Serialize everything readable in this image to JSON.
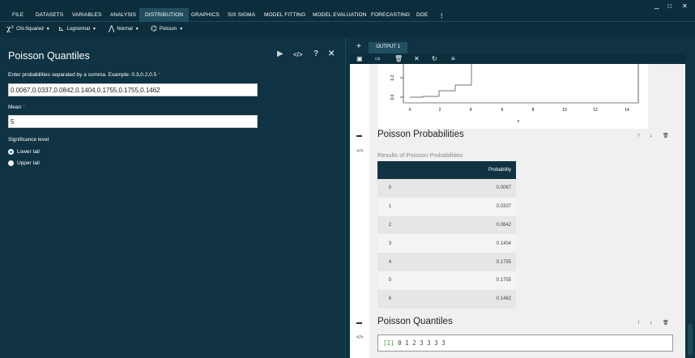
{
  "menu": {
    "items": [
      "FILE",
      "DATASETS",
      "VARIABLES",
      "ANALYSIS",
      "DISTRIBUTION",
      "GRAPHICS",
      "SIX SIGMA",
      "MODEL FITTING",
      "MODEL EVALUATION",
      "FORECASTING",
      "DOE",
      "⋮"
    ],
    "active": "DISTRIBUTION"
  },
  "window_controls": {
    "minimize": "_",
    "maximize": "□",
    "close": "✕"
  },
  "distributions": [
    {
      "glyph": "χ²",
      "label": "Chi-Squared",
      "icon": "chi-squared-icon"
    },
    {
      "glyph": "⊾",
      "label": "Lognormal",
      "icon": "lognormal-icon"
    },
    {
      "glyph": "⋀",
      "label": "Normal",
      "icon": "normal-curve-icon"
    },
    {
      "glyph": "⌬",
      "label": "Poisson",
      "icon": "poisson-icon"
    }
  ],
  "left_panel": {
    "title": "Poisson Quantiles",
    "actions": {
      "run": "▶",
      "code": "</>",
      "help": "?",
      "close": "✕"
    },
    "prob_label": "Enter probabilities separated by a comma. Example: 0.3,0.2,0.5",
    "prob_value": "0.0067,0.0337,0.0842,0.1404,0.1755,0.1755,0.1462",
    "mean_label": "Mean",
    "mean_value": "5",
    "significance_label": "Significance level",
    "tail_options": [
      "Lower tail",
      "Upper tail"
    ],
    "tail_selected": "Lower tail"
  },
  "output": {
    "add": "+",
    "tab_label": "OUTPUT 1",
    "toolbar_icons": [
      "save-icon",
      "export-icon",
      "trash-icon",
      "close-icon",
      "refresh-icon",
      "list-icon"
    ],
    "plot": {
      "y_ticks": [
        "0.2",
        "0.0"
      ],
      "x_ticks": [
        "0",
        "2",
        "4",
        "6",
        "8",
        "10",
        "12",
        "14"
      ],
      "xlabel": "x"
    },
    "probabilities_title": "Poisson Probabilities",
    "probabilities_subtitle": "Results of Poisson Probabilities",
    "table_header": [
      "",
      "Probability"
    ],
    "table_rows": [
      [
        "0",
        "0.0067"
      ],
      [
        "1",
        "0.0337"
      ],
      [
        "2",
        "0.0842"
      ],
      [
        "3",
        "0.1404"
      ],
      [
        "4",
        "0.1755"
      ],
      [
        "5",
        "0.1755"
      ],
      [
        "6",
        "0.1462"
      ]
    ],
    "quantiles_title": "Poisson Quantiles",
    "quantiles_prefix": "[1]",
    "quantiles_result": "0 1 2 3 3 3 3",
    "section_actions": {
      "up": "↑",
      "down": "↓",
      "delete": "🗑"
    }
  }
}
